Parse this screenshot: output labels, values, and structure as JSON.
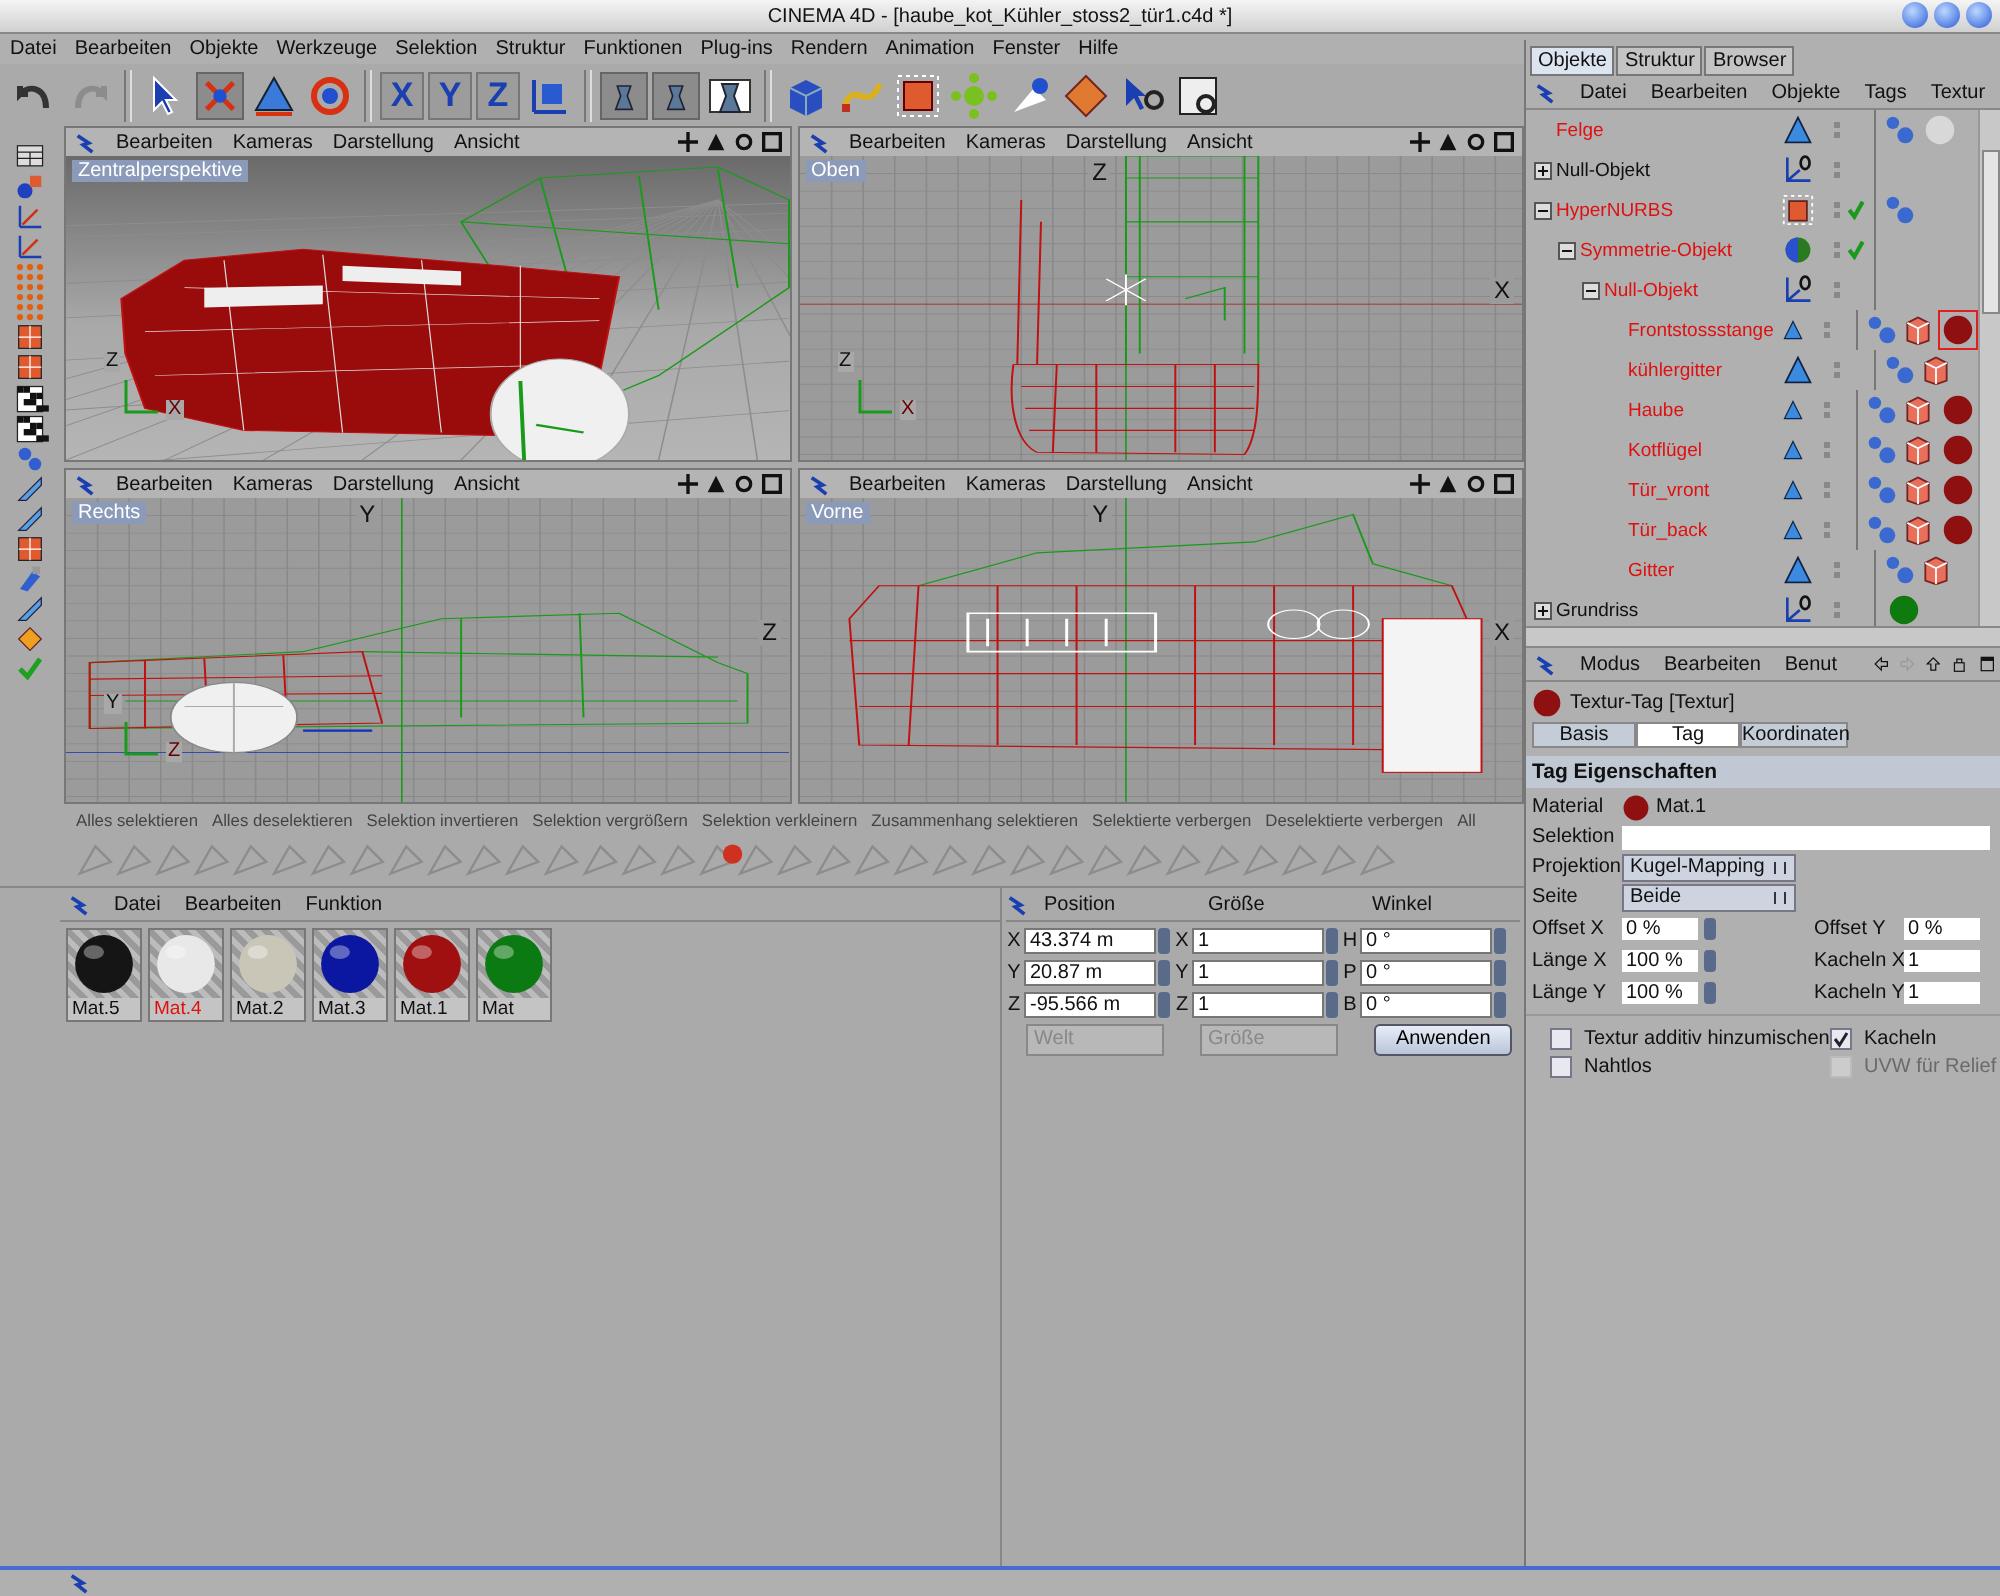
{
  "window": {
    "title": "CINEMA 4D - [haube_kot_Kühler_stoss2_tür1.c4d *]"
  },
  "menu": [
    "Datei",
    "Bearbeiten",
    "Objekte",
    "Werkzeuge",
    "Selektion",
    "Struktur",
    "Funktionen",
    "Plug-ins",
    "Rendern",
    "Animation",
    "Fenster",
    "Hilfe"
  ],
  "toolbar": {
    "axis_locks": [
      "X",
      "Y",
      "Z"
    ]
  },
  "viewports": [
    {
      "kind": "perspective",
      "label": "Zentralperspektive",
      "menu": [
        "Bearbeiten",
        "Kameras",
        "Darstellung",
        "Ansicht"
      ],
      "gizmo": [
        "Z",
        "X"
      ]
    },
    {
      "kind": "top",
      "label": "Oben",
      "menu": [
        "Bearbeiten",
        "Kameras",
        "Darstellung",
        "Ansicht"
      ],
      "axes": [
        {
          "label": "Z",
          "kind": "vertical"
        },
        {
          "label": "X",
          "kind": "horizontal"
        }
      ],
      "gizmo": [
        "Z",
        "X"
      ]
    },
    {
      "kind": "side",
      "label": "Rechts",
      "menu": [
        "Bearbeiten",
        "Kameras",
        "Darstellung",
        "Ansicht"
      ],
      "axes": [
        {
          "label": "Y",
          "kind": "vertical"
        },
        {
          "label": "Z",
          "kind": "horizontal"
        }
      ],
      "gizmo": [
        "Y",
        "Z"
      ]
    },
    {
      "kind": "front",
      "label": "Vorne",
      "menu": [
        "Bearbeiten",
        "Kameras",
        "Darstellung",
        "Ansicht"
      ],
      "axes": [
        {
          "label": "Y",
          "kind": "vertical"
        },
        {
          "label": "X",
          "kind": "horizontal"
        }
      ]
    }
  ],
  "commands": [
    "Alles selektieren",
    "Alles deselektieren",
    "Selektion invertieren",
    "Selektion vergrößern",
    "Selektion verkleinern",
    "Zusammenhang selektieren",
    "Selektierte verbergen",
    "Deselektierte verbergen",
    "All"
  ],
  "objects": {
    "tabs": [
      {
        "label": "Objekte",
        "selected": true
      },
      {
        "label": "Struktur",
        "selected": false
      },
      {
        "label": "Browser",
        "selected": false
      }
    ],
    "menu": [
      "Datei",
      "Bearbeiten",
      "Objekte",
      "Tags",
      "Textur"
    ],
    "tree": [
      {
        "name": "Felge",
        "kind": "polygon",
        "highlighted": true,
        "checked": false,
        "tags": [
          {
            "kind": "phong"
          },
          {
            "kind": "texture",
            "color": "#d8d8d8",
            "selected": false
          }
        ]
      },
      {
        "name": "Null-Objekt",
        "kind": "null",
        "highlighted": false,
        "checked": false,
        "expanded": false
      },
      {
        "name": "HyperNURBS",
        "kind": "hypernurbs",
        "highlighted": true,
        "checked": true,
        "expanded": true,
        "tags": [
          {
            "kind": "phong"
          }
        ],
        "children": [
          {
            "name": "Symmetrie-Objekt",
            "kind": "symmetry",
            "highlighted": true,
            "checked": true,
            "expanded": true,
            "children": [
              {
                "name": "Null-Objekt",
                "kind": "null",
                "highlighted": true,
                "checked": false,
                "expanded": true,
                "children": [
                  {
                    "name": "Frontstossstange",
                    "kind": "polygon",
                    "highlighted": true,
                    "checked": false,
                    "tags": [
                      {
                        "kind": "phong"
                      },
                      {
                        "kind": "uvw"
                      },
                      {
                        "kind": "texture",
                        "color": "#8e1010",
                        "selected": true
                      }
                    ]
                  },
                  {
                    "name": "kühlergitter",
                    "kind": "polygon",
                    "highlighted": true,
                    "checked": false,
                    "tags": [
                      {
                        "kind": "phong"
                      },
                      {
                        "kind": "uvw"
                      }
                    ]
                  },
                  {
                    "name": "Haube",
                    "kind": "polygon",
                    "highlighted": true,
                    "checked": false,
                    "tags": [
                      {
                        "kind": "phong"
                      },
                      {
                        "kind": "uvw"
                      },
                      {
                        "kind": "texture",
                        "color": "#8e1010",
                        "selected": false
                      }
                    ]
                  },
                  {
                    "name": "Kotflügel",
                    "kind": "polygon",
                    "highlighted": true,
                    "checked": false,
                    "tags": [
                      {
                        "kind": "phong"
                      },
                      {
                        "kind": "uvw"
                      },
                      {
                        "kind": "texture",
                        "color": "#8e1010",
                        "selected": false
                      }
                    ]
                  },
                  {
                    "name": "Tür_vront",
                    "kind": "polygon",
                    "highlighted": true,
                    "checked": false,
                    "tags": [
                      {
                        "kind": "phong"
                      },
                      {
                        "kind": "uvw"
                      },
                      {
                        "kind": "texture",
                        "color": "#8e1010",
                        "selected": false
                      }
                    ]
                  },
                  {
                    "name": "Tür_back",
                    "kind": "polygon",
                    "highlighted": true,
                    "checked": false,
                    "tags": [
                      {
                        "kind": "phong"
                      },
                      {
                        "kind": "uvw"
                      },
                      {
                        "kind": "texture",
                        "color": "#8e1010",
                        "selected": false
                      }
                    ]
                  },
                  {
                    "name": "Gitter",
                    "kind": "polygon",
                    "highlighted": true,
                    "checked": false,
                    "tags": [
                      {
                        "kind": "phong"
                      },
                      {
                        "kind": "uvw"
                      }
                    ]
                  }
                ]
              }
            ]
          }
        ]
      },
      {
        "name": "Grundriss",
        "kind": "null",
        "highlighted": false,
        "checked": false,
        "expanded": false,
        "tags": [
          {
            "kind": "texture",
            "color": "#0e7a10",
            "selected": false
          }
        ]
      }
    ]
  },
  "attributes": {
    "menu": [
      "Modus",
      "Bearbeiten",
      "Benut"
    ],
    "title": "Textur-Tag [Textur]",
    "tabs": [
      {
        "label": "Basis",
        "selected": false
      },
      {
        "label": "Tag",
        "selected": true
      },
      {
        "label": "Koordinaten",
        "selected": false
      }
    ],
    "section": "Tag Eigenschaften",
    "fields": [
      {
        "kind": "material",
        "label": "Material",
        "value": "Mat.1",
        "color": "#8e1010"
      },
      {
        "kind": "text",
        "label": "Selektion"
      },
      {
        "kind": "dropdown",
        "label": "Projektion",
        "value": "Kugel-Mapping"
      },
      {
        "kind": "dropdown",
        "label": "Seite",
        "value": "Beide"
      }
    ],
    "pairs": [
      [
        {
          "label": "Offset X",
          "value": "0 %",
          "kind": "spinner"
        },
        {
          "label": "Offset Y",
          "value": "0 %",
          "kind": "text"
        }
      ],
      [
        {
          "label": "Länge X",
          "value": "100 %",
          "kind": "spinner"
        },
        {
          "label": "Kacheln X",
          "value": "1",
          "kind": "text"
        }
      ],
      [
        {
          "label": "Länge Y",
          "value": "100 %",
          "kind": "spinner"
        },
        {
          "label": "Kacheln Y",
          "value": "1",
          "kind": "text"
        }
      ]
    ],
    "checkboxes": [
      {
        "label": "Textur additiv hinzumischen",
        "checked": false,
        "disabled": false
      },
      {
        "label": "Kacheln",
        "checked": true,
        "disabled": false
      },
      {
        "label": "Nahtlos",
        "checked": false,
        "disabled": false
      },
      {
        "label": "UVW für Relief",
        "checked": false,
        "disabled": true
      }
    ]
  },
  "materials": {
    "menu": [
      "Datei",
      "Bearbeiten",
      "Funktion"
    ],
    "items": [
      {
        "name": "Mat.5",
        "color": "#151515",
        "highlighted": false
      },
      {
        "name": "Mat.4",
        "color": "#e8e8e8",
        "highlighted": true
      },
      {
        "name": "Mat.2",
        "color": "#c9c6b8",
        "highlighted": false
      },
      {
        "name": "Mat.3",
        "color": "#0b17a0",
        "highlighted": false
      },
      {
        "name": "Mat.1",
        "color": "#a01010",
        "highlighted": false
      },
      {
        "name": "Mat",
        "color": "#0c7a12",
        "highlighted": false
      }
    ]
  },
  "coordinates": {
    "headers": [
      "Position",
      "Größe",
      "Winkel"
    ],
    "rows": [
      [
        {
          "axis": "X",
          "value": "43.374 m"
        },
        {
          "axis": "X",
          "value": "1"
        },
        {
          "axis": "H",
          "value": "0 °"
        }
      ],
      [
        {
          "axis": "Y",
          "value": "20.87 m"
        },
        {
          "axis": "Y",
          "value": "1"
        },
        {
          "axis": "P",
          "value": "0 °"
        }
      ],
      [
        {
          "axis": "Z",
          "value": "-95.566 m"
        },
        {
          "axis": "Z",
          "value": "1"
        },
        {
          "axis": "B",
          "value": "0 °"
        }
      ]
    ],
    "modes": [
      {
        "value": "Welt",
        "disabled": true
      },
      {
        "value": "Größe",
        "disabled": true
      }
    ],
    "apply": "Anwenden"
  }
}
